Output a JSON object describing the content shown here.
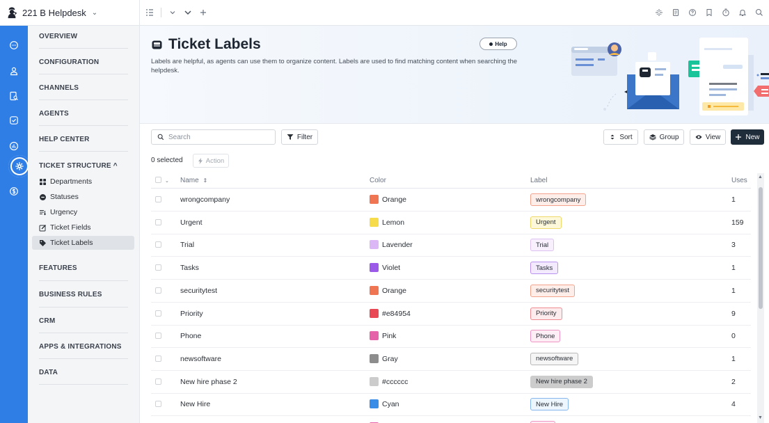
{
  "app": {
    "workspace_name": "221 B Helpdesk"
  },
  "sidebar": {
    "sections": [
      {
        "key": "overview",
        "label": "OVERVIEW"
      },
      {
        "key": "configuration",
        "label": "CONFIGURATION"
      },
      {
        "key": "channels",
        "label": "CHANNELS"
      },
      {
        "key": "agents",
        "label": "AGENTS"
      },
      {
        "key": "help_center",
        "label": "HELP CENTER"
      },
      {
        "key": "ticket_structure",
        "label": "TICKET STRUCTURE ^"
      },
      {
        "key": "features",
        "label": "FEATURES"
      },
      {
        "key": "business_rules",
        "label": "BUSINESS RULES"
      },
      {
        "key": "crm",
        "label": "CRM"
      },
      {
        "key": "apps",
        "label": "APPS & INTEGRATIONS"
      },
      {
        "key": "data",
        "label": "DATA"
      }
    ],
    "ticket_structure_items": [
      {
        "label": "Departments",
        "icon": "departments-icon"
      },
      {
        "label": "Statuses",
        "icon": "statuses-icon"
      },
      {
        "label": "Urgency",
        "icon": "urgency-icon"
      },
      {
        "label": "Ticket Fields",
        "icon": "ticket-fields-icon"
      },
      {
        "label": "Ticket Labels",
        "icon": "tag-icon",
        "active": true
      }
    ]
  },
  "header": {
    "title": "Ticket Labels",
    "help_label": "Help",
    "description": "Labels are helpful, as agents can use them to organize content. Labels are used to find matching content when searching the helpdesk."
  },
  "toolbar": {
    "search_placeholder": "Search",
    "filter_label": "Filter",
    "sort_label": "Sort",
    "group_label": "Group",
    "view_label": "View",
    "new_label": "New",
    "selected_text": "0 selected",
    "action_label": "Action"
  },
  "table": {
    "columns": {
      "name": "Name",
      "color": "Color",
      "label": "Label",
      "uses": "Uses"
    },
    "rows": [
      {
        "name": "wrongcompany",
        "color_name": "Orange",
        "swatch": "#f07553",
        "label": "wrongcompany",
        "chip_bg": "#fdeeea",
        "chip_border": "#f3a38c",
        "uses": "1"
      },
      {
        "name": "Urgent",
        "color_name": "Lemon",
        "swatch": "#f6dc4b",
        "label": "Urgent",
        "chip_bg": "#fdf8d9",
        "chip_border": "#efd96a",
        "uses": "159"
      },
      {
        "name": "Trial",
        "color_name": "Lavender",
        "swatch": "#dbb8f5",
        "label": "Trial",
        "chip_bg": "#f8f1fd",
        "chip_border": "#dcc1f1",
        "uses": "3"
      },
      {
        "name": "Tasks",
        "color_name": "Violet",
        "swatch": "#9b5be8",
        "label": "Tasks",
        "chip_bg": "#f3ebfd",
        "chip_border": "#b992ef",
        "uses": "1"
      },
      {
        "name": "securitytest",
        "color_name": "Orange",
        "swatch": "#f07553",
        "label": "securitytest",
        "chip_bg": "#fdeeea",
        "chip_border": "#f3a38c",
        "uses": "1"
      },
      {
        "name": "Priority",
        "color_name": "#e84954",
        "swatch": "#e84954",
        "label": "Priority",
        "chip_bg": "#fdeced",
        "chip_border": "#ef8a91",
        "uses": "9"
      },
      {
        "name": "Phone",
        "color_name": "Pink",
        "swatch": "#e563a8",
        "label": "Phone",
        "chip_bg": "#fdeef6",
        "chip_border": "#ee95c4",
        "uses": "0"
      },
      {
        "name": "newsoftware",
        "color_name": "Gray",
        "swatch": "#8d8d8d",
        "label": "newsoftware",
        "chip_bg": "#f5f5f5",
        "chip_border": "#b8b8b8",
        "uses": "1"
      },
      {
        "name": "New hire phase 2",
        "color_name": "#cccccc",
        "swatch": "#cccccc",
        "label": "New hire phase 2",
        "chip_bg": "#cccccc",
        "chip_border": "#cccccc",
        "uses": "2"
      },
      {
        "name": "New Hire",
        "color_name": "Cyan",
        "swatch": "#3a8de6",
        "label": "New Hire",
        "chip_bg": "#edf5fd",
        "chip_border": "#86b6ee",
        "uses": "4"
      },
      {
        "name": "",
        "color_name": "",
        "swatch": "#e563a8",
        "label": "",
        "chip_bg": "#fdeef6",
        "chip_border": "#ee95c4",
        "uses": ""
      }
    ]
  },
  "colors": {
    "rail_bg": "#2f7ee6",
    "primary_button": "#1f2c3a",
    "nav_bg": "#f4f5f7"
  }
}
